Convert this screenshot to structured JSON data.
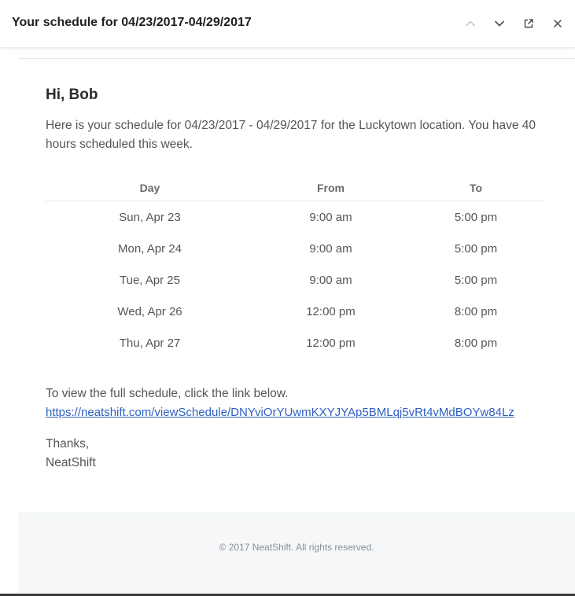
{
  "window": {
    "title": "Your schedule for 04/23/2017-04/29/2017",
    "icons": {
      "up": "chevron-up-icon",
      "down": "chevron-down-icon",
      "open": "external-link-icon",
      "close": "close-icon"
    }
  },
  "email": {
    "greeting": "Hi, Bob",
    "intro": "Here is your schedule for 04/23/2017 - 04/29/2017 for the Luckytown location. You have 40 hours scheduled this week.",
    "table": {
      "headers": [
        "Day",
        "From",
        "To"
      ],
      "rows": [
        {
          "day": "Sun, Apr 23",
          "from": "9:00 am",
          "to": "5:00 pm"
        },
        {
          "day": "Mon, Apr 24",
          "from": "9:00 am",
          "to": "5:00 pm"
        },
        {
          "day": "Tue, Apr 25",
          "from": "9:00 am",
          "to": "5:00 pm"
        },
        {
          "day": "Wed, Apr 26",
          "from": "12:00 pm",
          "to": "8:00 pm"
        },
        {
          "day": "Thu, Apr 27",
          "from": "12:00 pm",
          "to": "8:00 pm"
        }
      ]
    },
    "view_text": "To view the full schedule, click the link below.",
    "link": "https://neatshift.com/viewSchedule/DNYviOrYUwmKXYJYAp5BMLqj5vRt4vMdBOYw84Lz",
    "thanks": "Thanks,",
    "signature": "NeatShift",
    "footer": "© 2017 NeatShift. All rights reserved."
  },
  "colors": {
    "link": "#2e5fc2",
    "footer_bg": "#f5f7f9",
    "text": "#555555"
  }
}
